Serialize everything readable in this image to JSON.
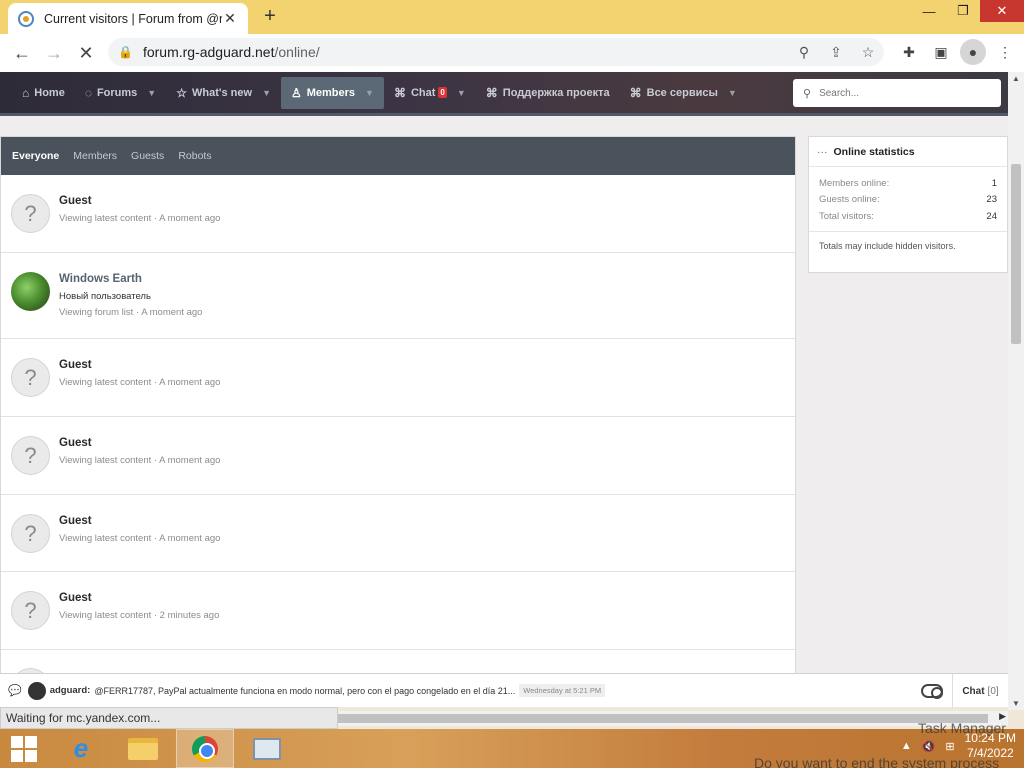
{
  "browser": {
    "tab_title": "Current visitors | Forum from @r",
    "tab_close": "✕",
    "new_tab": "+",
    "url_domain": "forum.rg-adguard.net",
    "url_path": "/online/",
    "status_text": "Waiting for mc.yandex.com..."
  },
  "nav": {
    "items": [
      {
        "label": "Home",
        "icon": "home-icon"
      },
      {
        "label": "Forums",
        "icon": "forums-icon"
      },
      {
        "label": "What's new",
        "icon": "star-icon"
      },
      {
        "label": "Members",
        "icon": "user-icon"
      },
      {
        "label": "Chat",
        "icon": "tag-icon",
        "badge": "0"
      },
      {
        "label": "Поддержка проекта",
        "icon": "tag-icon"
      },
      {
        "label": "Все сервисы",
        "icon": "tag-icon"
      }
    ],
    "search_placeholder": "Search..."
  },
  "filters": [
    "Everyone",
    "Members",
    "Guests",
    "Robots"
  ],
  "visitors": [
    {
      "name": "Guest",
      "title": "",
      "activity": "Viewing latest content · A moment ago"
    },
    {
      "name": "Windows Earth",
      "title": "Новый пользователь",
      "activity": "Viewing forum list · A moment ago"
    },
    {
      "name": "Guest",
      "title": "",
      "activity": "Viewing latest content · A moment ago"
    },
    {
      "name": "Guest",
      "title": "",
      "activity": "Viewing latest content · A moment ago"
    },
    {
      "name": "Guest",
      "title": "",
      "activity": "Viewing latest content · A moment ago"
    },
    {
      "name": "Guest",
      "title": "",
      "activity": "Viewing latest content · 2 minutes ago"
    }
  ],
  "stats": {
    "title": "Online statistics",
    "rows": [
      {
        "label": "Members online:",
        "value": "1"
      },
      {
        "label": "Guests online:",
        "value": "23"
      },
      {
        "label": "Total visitors:",
        "value": "24"
      }
    ],
    "note": "Totals may include hidden visitors."
  },
  "chat": {
    "user": "adguard:",
    "message": "@FERR17787, PayPal actualmente funciona en modo normal, pero con el pago congelado en el día 21...",
    "time": "Wednesday at 5:21 PM",
    "button": "Chat",
    "count": "[0]"
  },
  "taskbar": {
    "time": "10:24 PM",
    "date": "7/4/2022",
    "ghost_title": "Task Manager",
    "ghost_dialog": "Do you want to end the system process"
  }
}
